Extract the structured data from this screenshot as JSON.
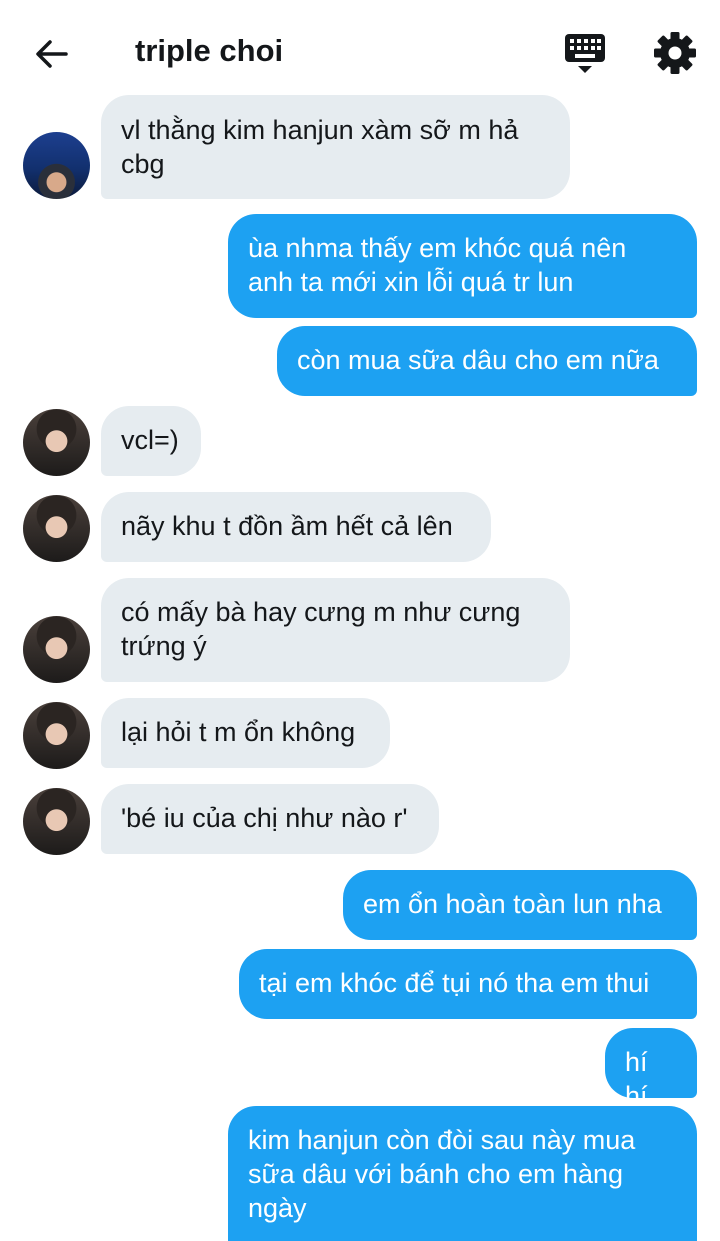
{
  "header": {
    "title": "triple choi",
    "back_icon": "arrow-left-icon",
    "keyboard_icon": "keyboard-icon",
    "settings_icon": "gear-icon"
  },
  "colors": {
    "incoming_bubble": "#e6ecf0",
    "outgoing_bubble": "#1da1f2",
    "text": "#14171a"
  },
  "messages": [
    {
      "from": "them",
      "text": "vl thằng kim hanjun xàm sỡ m hả\ncbg"
    },
    {
      "from": "me",
      "text": "ùa nhma thấy em khóc quá nên\nanh ta mới xin lỗi quá tr lun"
    },
    {
      "from": "me",
      "text": "còn mua sữa dâu cho em nữa"
    },
    {
      "from": "them",
      "text": "vcl=)"
    },
    {
      "from": "them",
      "text": "nãy khu t đồn ầm hết cả lên"
    },
    {
      "from": "them",
      "text": "có mấy bà hay cưng m như cưng\ntrứng ý"
    },
    {
      "from": "them",
      "text": "lại hỏi t m ổn không"
    },
    {
      "from": "them",
      "text": "'bé iu của chị như nào r'"
    },
    {
      "from": "me",
      "text": "em ổn hoàn toàn lun nha"
    },
    {
      "from": "me",
      "text": "tại em khóc để tụi nó tha em thui"
    },
    {
      "from": "me",
      "text": "hí hí"
    },
    {
      "from": "me",
      "text": "kim hanjun còn đòi sau này mua\nsữa dâu với bánh cho em hàng\nngày"
    }
  ]
}
